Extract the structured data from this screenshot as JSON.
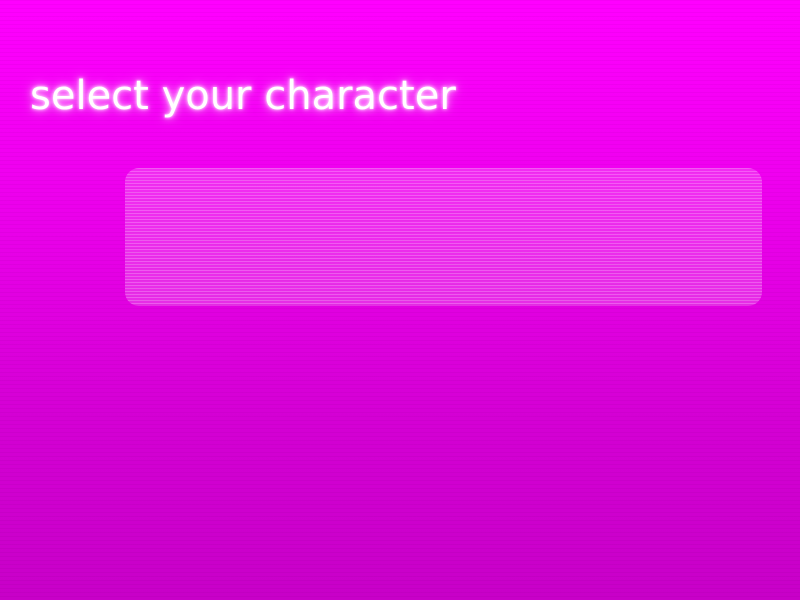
{
  "screen": {
    "title": "select your character"
  },
  "colors": {
    "background_top": "#ff00ff",
    "background_bottom": "#c800c8",
    "title_text": "#ffffff",
    "panel_tint": "#ffc8ff"
  }
}
